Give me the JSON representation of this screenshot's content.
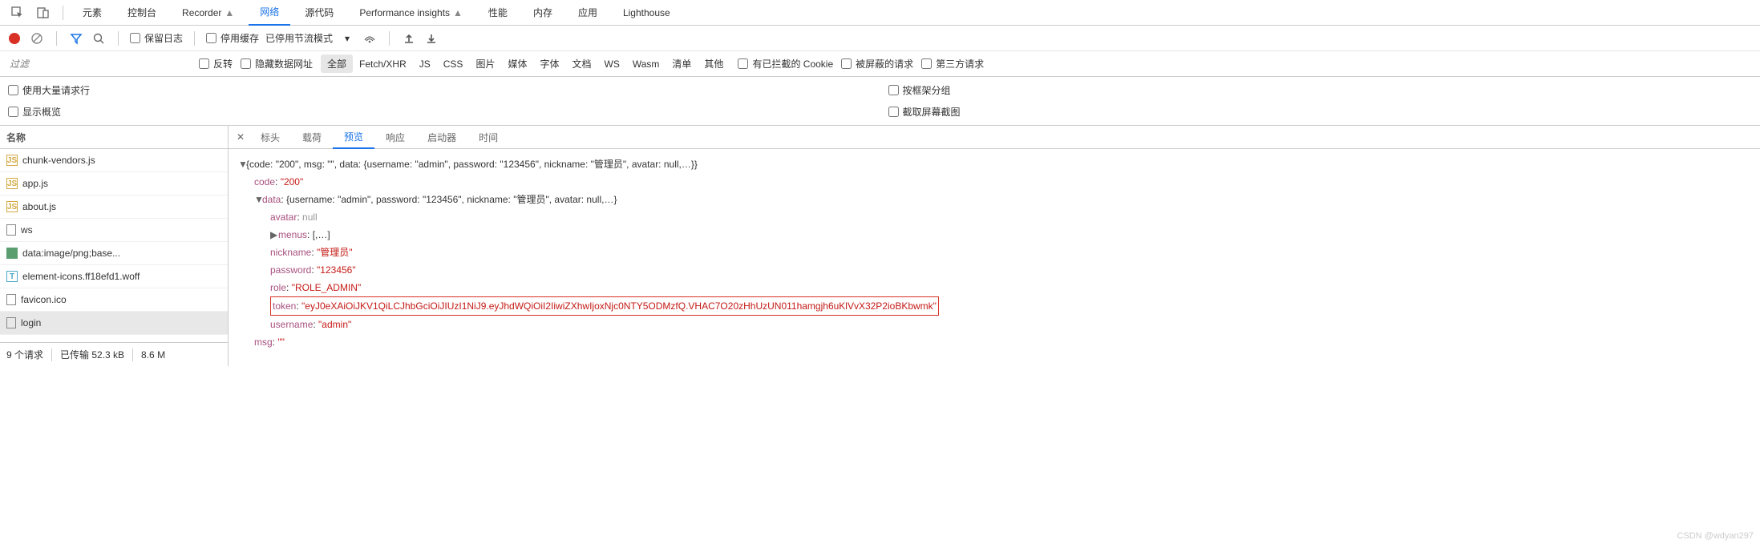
{
  "topTabs": {
    "elements": "元素",
    "console": "控制台",
    "recorder": "Recorder",
    "network": "网络",
    "sources": "源代码",
    "perfInsights": "Performance insights",
    "performance": "性能",
    "memory": "内存",
    "application": "应用",
    "lighthouse": "Lighthouse"
  },
  "toolbar": {
    "preserveLog": "保留日志",
    "disableCache": "停用缓存",
    "throttling": "已停用节流模式"
  },
  "filterBar": {
    "placeholder": "过滤",
    "invert": "反转",
    "hideDataUrls": "隐藏数据网址",
    "types": {
      "all": "全部",
      "fetch": "Fetch/XHR",
      "js": "JS",
      "css": "CSS",
      "img": "图片",
      "media": "媒体",
      "font": "字体",
      "doc": "文档",
      "ws": "WS",
      "wasm": "Wasm",
      "manifest": "清单",
      "other": "其他"
    },
    "blockedCookies": "有已拦截的 Cookie",
    "blockedRequests": "被屏蔽的请求",
    "thirdParty": "第三方请求"
  },
  "options": {
    "largeRows": "使用大量请求行",
    "overview": "显示概览",
    "groupByFrame": "按框架分组",
    "screenshots": "截取屏幕截图"
  },
  "reqList": {
    "header": "名称",
    "items": [
      {
        "name": "chunk-vendors.js",
        "icon": "js",
        "cut": true
      },
      {
        "name": "app.js",
        "icon": "js"
      },
      {
        "name": "about.js",
        "icon": "js"
      },
      {
        "name": "ws",
        "icon": "doc"
      },
      {
        "name": "data:image/png;base...",
        "icon": "img"
      },
      {
        "name": "element-icons.ff18efd1.woff",
        "icon": "font"
      },
      {
        "name": "favicon.ico",
        "icon": "doc"
      },
      {
        "name": "login",
        "icon": "doc",
        "selected": true
      }
    ],
    "status": {
      "requests": "9 个请求",
      "transferred": "已传输 52.3 kB",
      "resources": "8.6 M"
    }
  },
  "detailTabs": {
    "headers": "标头",
    "payload": "载荷",
    "preview": "预览",
    "response": "响应",
    "initiator": "启动器",
    "timing": "时间"
  },
  "json": {
    "summary": "{code: \"200\", msg: \"\", data: {username: \"admin\", password: \"123456\", nickname: \"管理员\", avatar: null,…}}",
    "code_k": "code",
    "code_v": "\"200\"",
    "data_k": "data",
    "data_summary": "{username: \"admin\", password: \"123456\", nickname: \"管理员\", avatar: null,…}",
    "avatar_k": "avatar",
    "avatar_v": "null",
    "menus_k": "menus",
    "menus_v": "[,…]",
    "nickname_k": "nickname",
    "nickname_v": "\"管理员\"",
    "password_k": "password",
    "password_v": "\"123456\"",
    "role_k": "role",
    "role_v": "\"ROLE_ADMIN\"",
    "token_k": "token",
    "token_v": "\"eyJ0eXAiOiJKV1QiLCJhbGciOiJIUzI1NiJ9.eyJhdWQiOiI2IiwiZXhwIjoxNjc0NTY5ODMzfQ.VHAC7O20zHhUzUN011hamgjh6uKlVvX32P2ioBKbwmk\"",
    "username_k": "username",
    "username_v": "\"admin\"",
    "msg_k": "msg",
    "msg_v": "\"\""
  },
  "watermark": "CSDN @wdyan297"
}
